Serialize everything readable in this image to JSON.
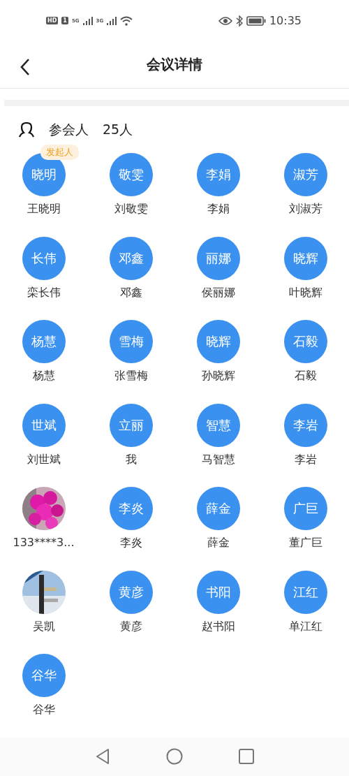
{
  "status_bar": {
    "hd": "HD",
    "sim": "1",
    "signals": [
      "5G",
      "3G"
    ],
    "time": "10:35"
  },
  "header": {
    "title": "会议详情"
  },
  "attendees": {
    "label": "参会人",
    "count": "25人",
    "members": [
      {
        "kind": "initials",
        "avatar": "晓明",
        "name": "王晓明",
        "badge": "发起人"
      },
      {
        "kind": "initials",
        "avatar": "敬雯",
        "name": "刘敬雯"
      },
      {
        "kind": "initials",
        "avatar": "李娟",
        "name": "李娟"
      },
      {
        "kind": "initials",
        "avatar": "淑芳",
        "name": "刘淑芳"
      },
      {
        "kind": "initials",
        "avatar": "长伟",
        "name": "栾长伟"
      },
      {
        "kind": "initials",
        "avatar": "邓鑫",
        "name": "邓鑫"
      },
      {
        "kind": "initials",
        "avatar": "丽娜",
        "name": "侯丽娜"
      },
      {
        "kind": "initials",
        "avatar": "晓辉",
        "name": "叶晓辉"
      },
      {
        "kind": "initials",
        "avatar": "杨慧",
        "name": "杨慧"
      },
      {
        "kind": "initials",
        "avatar": "雪梅",
        "name": "张雪梅"
      },
      {
        "kind": "initials",
        "avatar": "晓辉",
        "name": "孙晓辉"
      },
      {
        "kind": "initials",
        "avatar": "石毅",
        "name": "石毅"
      },
      {
        "kind": "initials",
        "avatar": "世斌",
        "name": "刘世斌"
      },
      {
        "kind": "initials",
        "avatar": "立丽",
        "name": "我"
      },
      {
        "kind": "initials",
        "avatar": "智慧",
        "name": "马智慧"
      },
      {
        "kind": "initials",
        "avatar": "李岩",
        "name": "李岩"
      },
      {
        "kind": "flowers",
        "name": "133****3..."
      },
      {
        "kind": "initials",
        "avatar": "李炎",
        "name": "李炎"
      },
      {
        "kind": "initials",
        "avatar": "薛金",
        "name": "薛金"
      },
      {
        "kind": "initials",
        "avatar": "广巨",
        "name": "董广巨"
      },
      {
        "kind": "signpost",
        "name": "吴凯"
      },
      {
        "kind": "initials",
        "avatar": "黄彦",
        "name": "黄彦"
      },
      {
        "kind": "initials",
        "avatar": "书阳",
        "name": "赵书阳"
      },
      {
        "kind": "initials",
        "avatar": "江红",
        "name": "单江红"
      },
      {
        "kind": "initials",
        "avatar": "谷华",
        "name": "谷华"
      }
    ]
  }
}
